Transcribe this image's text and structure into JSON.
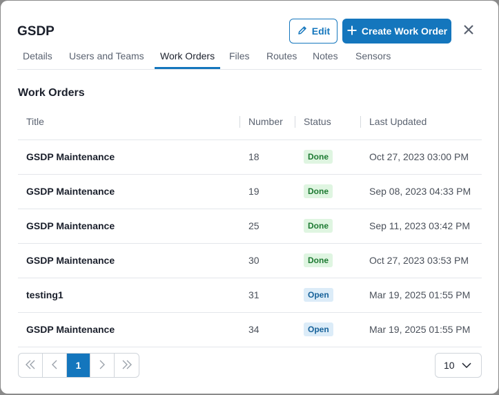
{
  "header": {
    "title": "GSDP",
    "edit_label": "Edit",
    "create_label": "Create Work Order"
  },
  "tabs": [
    {
      "label": "Details"
    },
    {
      "label": "Users and Teams"
    },
    {
      "label": "Work Orders",
      "active": true
    },
    {
      "label": "Files"
    },
    {
      "label": "Routes"
    },
    {
      "label": "Notes"
    },
    {
      "label": "Sensors"
    }
  ],
  "section": {
    "title": "Work Orders"
  },
  "table": {
    "columns": [
      "Title",
      "Number",
      "Status",
      "Last Updated"
    ],
    "rows": [
      {
        "title": "GSDP Maintenance",
        "number": "18",
        "status": "Done",
        "updated": "Oct 27, 2023 03:00 PM"
      },
      {
        "title": "GSDP Maintenance",
        "number": "19",
        "status": "Done",
        "updated": "Sep 08, 2023 04:33 PM"
      },
      {
        "title": "GSDP Maintenance",
        "number": "25",
        "status": "Done",
        "updated": "Sep 11, 2023 03:42 PM"
      },
      {
        "title": "GSDP Maintenance",
        "number": "30",
        "status": "Done",
        "updated": "Oct 27, 2023 03:53 PM"
      },
      {
        "title": "testing1",
        "number": "31",
        "status": "Open",
        "updated": "Mar 19, 2025 01:55 PM"
      },
      {
        "title": "GSDP Maintenance",
        "number": "34",
        "status": "Open",
        "updated": "Mar 19, 2025 01:55 PM"
      }
    ]
  },
  "pagination": {
    "current_page": "1",
    "page_size": "10"
  },
  "colors": {
    "accent": "#1476bd",
    "done_bg": "#dff5e1",
    "open_bg": "#dcecf8"
  }
}
